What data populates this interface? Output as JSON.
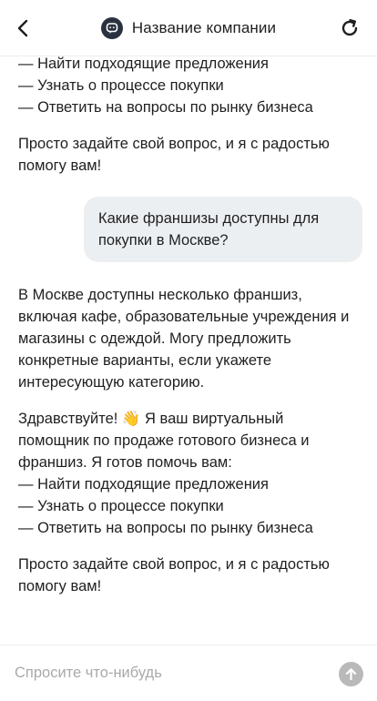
{
  "header": {
    "title": "Название компании",
    "back_icon": "back-chevron-icon",
    "refresh_icon": "refresh-icon",
    "logo_icon": "chat-bot-logo-icon"
  },
  "messages": [
    {
      "role": "bot",
      "paragraphs": [
        [
          "— Найти подходящие предложения",
          "— Узнать о процессе покупки",
          "— Ответить на вопросы по рынку бизнеса"
        ],
        [
          "Просто задайте свой вопрос, и я с радостью",
          "помогу вам!"
        ]
      ]
    },
    {
      "role": "user",
      "lines": [
        "Какие франшизы доступны для",
        "покупки в Москве?"
      ]
    },
    {
      "role": "bot",
      "paragraphs": [
        [
          "В Москве доступны несколько франшиз,",
          "включая кафе, образовательные учреждения и",
          "магазины с одеждой. Могу предложить",
          "конкретные варианты, если укажете",
          "интересующую категорию."
        ],
        [
          "Здравствуйте! 👋 Я ваш виртуальный",
          "помощник по продаже готового бизнеса и",
          "франшиз. Я готов помочь вам:",
          "— Найти подходящие предложения",
          "— Узнать о процессе покупки",
          "— Ответить на вопросы по рынку бизнеса"
        ],
        [
          "Просто задайте свой вопрос, и я с радостью",
          "помогу вам!"
        ]
      ]
    }
  ],
  "composer": {
    "placeholder": "Спросите что-нибудь",
    "value": "",
    "send_icon": "send-arrow-up-icon"
  },
  "colors": {
    "text": "#1f1f1f",
    "user_bubble": "#eceff2",
    "send_button": "#b9b9b9",
    "placeholder": "#a9a9a9",
    "logo_bg": "#2a3140"
  }
}
